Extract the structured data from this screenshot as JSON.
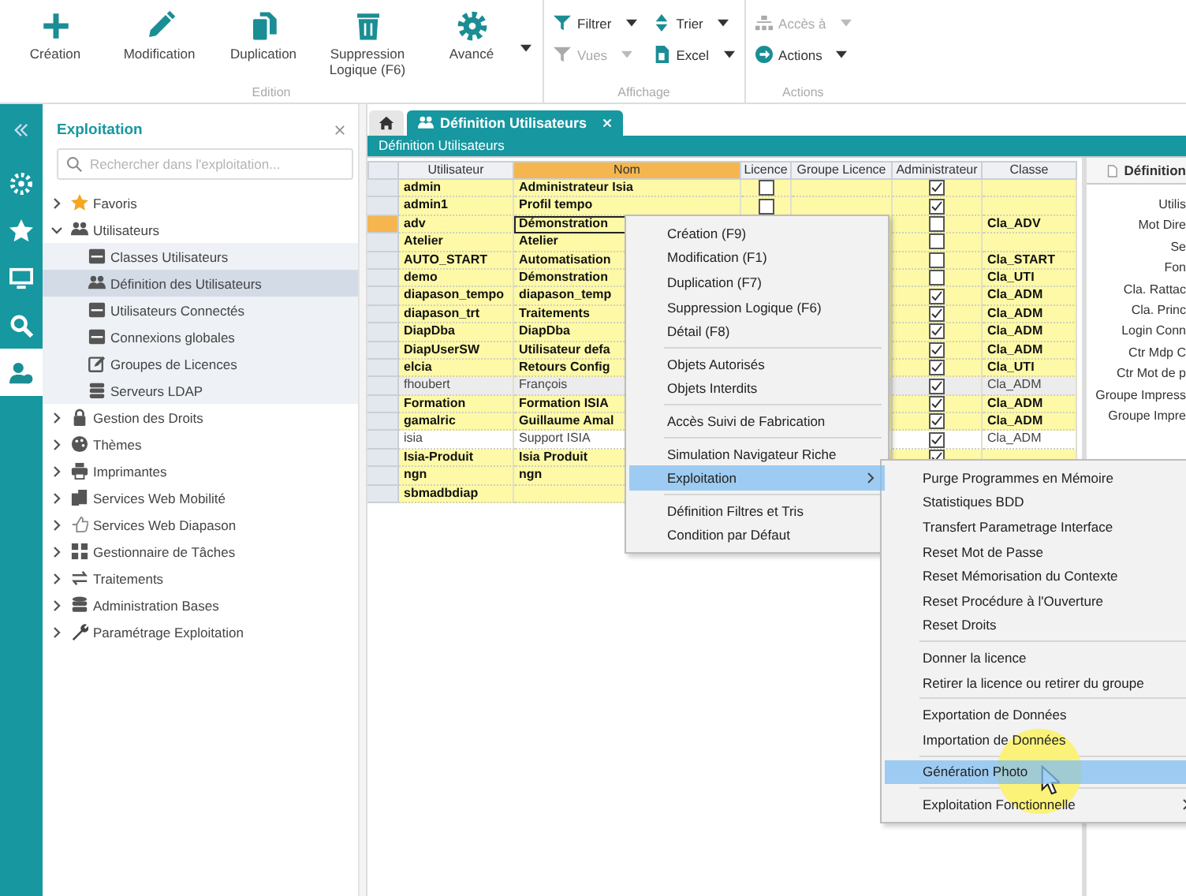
{
  "toolbar": {
    "groups": [
      {
        "label": "Edition",
        "kind": "large",
        "buttons": [
          {
            "label": "Création",
            "dropdown": false
          },
          {
            "label": "Modification",
            "dropdown": false
          },
          {
            "label": "Duplication",
            "dropdown": false
          },
          {
            "label": "Suppression Logique (F6)",
            "dropdown": false
          },
          {
            "label": "Avancé",
            "dropdown": true
          }
        ]
      },
      {
        "label": "Affichage",
        "kind": "small",
        "buttons": [
          {
            "label": "Filtrer",
            "disabled": false
          },
          {
            "label": "Trier",
            "disabled": false
          },
          {
            "label": "Vues",
            "disabled": true
          },
          {
            "label": "Excel",
            "disabled": false
          }
        ]
      },
      {
        "label": "Actions",
        "kind": "small1",
        "buttons": [
          {
            "label": "Accès à",
            "disabled": true
          },
          {
            "label": "Actions",
            "disabled": false
          }
        ]
      }
    ]
  },
  "rail": [
    {
      "selected": false
    },
    {
      "selected": false
    },
    {
      "selected": false
    },
    {
      "selected": false
    },
    {
      "selected": true
    }
  ],
  "sidebar": {
    "title": "Exploitation",
    "search": {
      "placeholder": "Rechercher dans l'exploitation..."
    },
    "tree": [
      {
        "label": "Favoris",
        "expanded": false
      },
      {
        "label": "Utilisateurs",
        "expanded": true,
        "children": [
          {
            "label": "Classes Utilisateurs",
            "selected": false
          },
          {
            "label": "Définition des Utilisateurs",
            "selected": true
          },
          {
            "label": "Utilisateurs Connectés",
            "selected": false
          },
          {
            "label": "Connexions globales",
            "selected": false
          },
          {
            "label": "Groupes de Licences",
            "selected": false
          },
          {
            "label": "Serveurs LDAP",
            "selected": false
          }
        ]
      },
      {
        "label": "Gestion des Droits",
        "expanded": false
      },
      {
        "label": "Thèmes",
        "expanded": false
      },
      {
        "label": "Imprimantes",
        "expanded": false
      },
      {
        "label": "Services Web Mobilité",
        "expanded": false
      },
      {
        "label": "Services Web Diapason",
        "expanded": false
      },
      {
        "label": "Gestionnaire de Tâches",
        "expanded": false
      },
      {
        "label": "Traitements",
        "expanded": false
      },
      {
        "label": "Administration  Bases",
        "expanded": false
      },
      {
        "label": "Paramétrage Exploitation",
        "expanded": false
      }
    ]
  },
  "tabs": [
    {
      "kind": "home",
      "selected": false
    },
    {
      "kind": "page",
      "label": "Définition Utilisateurs",
      "selected": true
    }
  ],
  "panel": {
    "title": "Définition Utilisateurs",
    "columns": [
      "Utilisateur",
      "Nom",
      "Licence",
      "Groupe Licence",
      "Administrateur",
      "Classe"
    ],
    "rows": [
      {
        "user": "admin",
        "name": "Administrateur Isia",
        "licence": false,
        "admin": true,
        "kind": "bold",
        "selected": false
      },
      {
        "user": "admin1",
        "name": "Profil tempo",
        "licence": false,
        "admin": true,
        "kind": "bold",
        "selected": false
      },
      {
        "user": "adv",
        "name": "Démonstration",
        "admin": false,
        "classe": "Cla_ADV",
        "kind": "bold",
        "selected": true
      },
      {
        "user": "Atelier",
        "name": "Atelier",
        "admin": false,
        "kind": "bold",
        "selected": false
      },
      {
        "user": "AUTO_START",
        "name": "Automatisation",
        "admin": false,
        "classe": "Cla_START",
        "kind": "bold",
        "selected": false
      },
      {
        "user": "demo",
        "name": "Démonstration",
        "admin": false,
        "classe": "Cla_UTI",
        "kind": "bold",
        "selected": false
      },
      {
        "user": "diapason_tempo",
        "name": "diapason_temp",
        "admin": true,
        "classe": "Cla_ADM",
        "kind": "bold",
        "selected": false
      },
      {
        "user": "diapason_trt",
        "name": "Traitements",
        "admin": true,
        "classe": "Cla_ADM",
        "kind": "bold",
        "selected": false
      },
      {
        "user": "DiapDba",
        "name": "DiapDba",
        "admin": true,
        "classe": "Cla_ADM",
        "kind": "bold",
        "selected": false
      },
      {
        "user": "DiapUserSW",
        "name": "Utilisateur defa",
        "admin": true,
        "classe": "Cla_ADM",
        "kind": "bold",
        "selected": false
      },
      {
        "user": "elcia",
        "name": "Retours Config",
        "admin": true,
        "classe": "Cla_UTI",
        "kind": "bold",
        "selected": false
      },
      {
        "user": "fhoubert",
        "name": "François",
        "admin": true,
        "classe": "Cla_ADM",
        "kind": "grey",
        "selected": false
      },
      {
        "user": "Formation",
        "name": "Formation ISIA",
        "admin": true,
        "classe": "Cla_ADM",
        "kind": "bold",
        "selected": false
      },
      {
        "user": "gamalric",
        "name": "Guillaume Amal",
        "admin": true,
        "classe": "Cla_ADM",
        "kind": "bold",
        "selected": false
      },
      {
        "user": "isia",
        "name": "Support ISIA",
        "admin": true,
        "classe": "Cla_ADM",
        "kind": "plain",
        "selected": false
      },
      {
        "user": "Isia-Produit",
        "name": "Isia Produit",
        "admin": true,
        "kind": "bold",
        "selected": false
      },
      {
        "user": "ngn",
        "name": "ngn",
        "kind": "bold",
        "selected": false
      },
      {
        "user": "sbmadbdiap",
        "kind": "bold",
        "selected": false
      }
    ]
  },
  "detail": {
    "tab": "Définition",
    "labels": [
      "Utilis",
      "Mot Dire",
      "Se",
      "Fon",
      "Cla. Rattac",
      "Cla. Princ",
      "Login Conn",
      "Ctr Mdp C",
      "Ctr Mot de p",
      "Groupe Impress",
      "Groupe Impre"
    ]
  },
  "context_menu": {
    "sections": [
      [
        {
          "label": "Création (F9)",
          "selected": false,
          "submenu": false
        },
        {
          "label": "Modification (F1)",
          "selected": false,
          "submenu": false
        },
        {
          "label": "Duplication (F7)",
          "selected": false,
          "submenu": false
        },
        {
          "label": "Suppression Logique (F6)",
          "selected": false,
          "submenu": false
        },
        {
          "label": "Détail (F8)",
          "selected": false,
          "submenu": false
        }
      ],
      [
        {
          "label": "Objets Autorisés",
          "selected": false,
          "submenu": false
        },
        {
          "label": "Objets Interdits",
          "selected": false,
          "submenu": false
        }
      ],
      [
        {
          "label": "Accès Suivi de Fabrication",
          "selected": false,
          "submenu": false
        }
      ],
      [
        {
          "label": "Simulation Navigateur Riche",
          "selected": false,
          "submenu": false
        },
        {
          "label": "Exploitation",
          "selected": true,
          "submenu": true
        }
      ],
      [
        {
          "label": "Définition Filtres et Tris",
          "selected": false,
          "submenu": false
        },
        {
          "label": "Condition par Défaut",
          "selected": false,
          "submenu": false
        }
      ]
    ]
  },
  "submenu": {
    "sections": [
      [
        {
          "label": "Purge Programmes en Mémoire",
          "selected": false,
          "submenu": false
        },
        {
          "label": "Statistiques BDD",
          "selected": false,
          "submenu": false
        },
        {
          "label": "Transfert Parametrage Interface",
          "selected": false,
          "submenu": false
        },
        {
          "label": "Reset Mot de Passe",
          "selected": false,
          "submenu": false
        },
        {
          "label": "Reset Mémorisation du Contexte",
          "selected": false,
          "submenu": false
        },
        {
          "label": "Reset Procédure à l'Ouverture",
          "selected": false,
          "submenu": false
        },
        {
          "label": "Reset Droits",
          "selected": false,
          "submenu": false
        }
      ],
      [
        {
          "label": "Donner la licence",
          "selected": false,
          "submenu": false
        },
        {
          "label": "Retirer la licence ou retirer du groupe",
          "selected": false,
          "submenu": false
        }
      ],
      [
        {
          "label": "Exportation de Données",
          "selected": false,
          "submenu": false
        },
        {
          "label": "Importation de Données",
          "selected": false,
          "submenu": false
        }
      ],
      [
        {
          "label": "Génération Photo",
          "selected": true,
          "submenu": false
        }
      ],
      [
        {
          "label": "Exploitation Fonctionnelle",
          "selected": false,
          "submenu": true
        }
      ]
    ]
  }
}
